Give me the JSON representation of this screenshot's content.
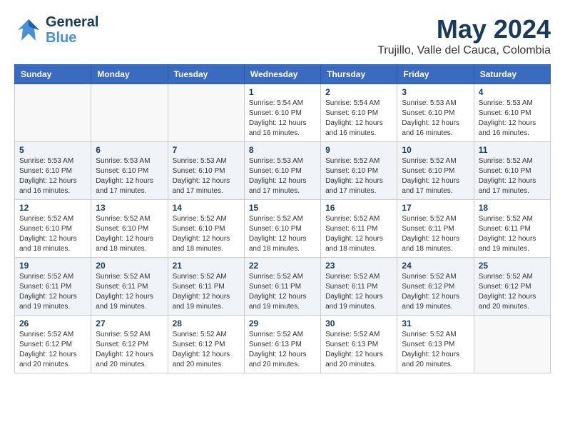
{
  "header": {
    "logo_line1": "General",
    "logo_line2": "Blue",
    "title": "May 2024",
    "subtitle": "Trujillo, Valle del Cauca, Colombia"
  },
  "weekdays": [
    "Sunday",
    "Monday",
    "Tuesday",
    "Wednesday",
    "Thursday",
    "Friday",
    "Saturday"
  ],
  "weeks": [
    [
      {
        "day": "",
        "info": ""
      },
      {
        "day": "",
        "info": ""
      },
      {
        "day": "",
        "info": ""
      },
      {
        "day": "1",
        "info": "Sunrise: 5:54 AM\nSunset: 6:10 PM\nDaylight: 12 hours\nand 16 minutes."
      },
      {
        "day": "2",
        "info": "Sunrise: 5:54 AM\nSunset: 6:10 PM\nDaylight: 12 hours\nand 16 minutes."
      },
      {
        "day": "3",
        "info": "Sunrise: 5:53 AM\nSunset: 6:10 PM\nDaylight: 12 hours\nand 16 minutes."
      },
      {
        "day": "4",
        "info": "Sunrise: 5:53 AM\nSunset: 6:10 PM\nDaylight: 12 hours\nand 16 minutes."
      }
    ],
    [
      {
        "day": "5",
        "info": "Sunrise: 5:53 AM\nSunset: 6:10 PM\nDaylight: 12 hours\nand 16 minutes."
      },
      {
        "day": "6",
        "info": "Sunrise: 5:53 AM\nSunset: 6:10 PM\nDaylight: 12 hours\nand 17 minutes."
      },
      {
        "day": "7",
        "info": "Sunrise: 5:53 AM\nSunset: 6:10 PM\nDaylight: 12 hours\nand 17 minutes."
      },
      {
        "day": "8",
        "info": "Sunrise: 5:53 AM\nSunset: 6:10 PM\nDaylight: 12 hours\nand 17 minutes."
      },
      {
        "day": "9",
        "info": "Sunrise: 5:52 AM\nSunset: 6:10 PM\nDaylight: 12 hours\nand 17 minutes."
      },
      {
        "day": "10",
        "info": "Sunrise: 5:52 AM\nSunset: 6:10 PM\nDaylight: 12 hours\nand 17 minutes."
      },
      {
        "day": "11",
        "info": "Sunrise: 5:52 AM\nSunset: 6:10 PM\nDaylight: 12 hours\nand 17 minutes."
      }
    ],
    [
      {
        "day": "12",
        "info": "Sunrise: 5:52 AM\nSunset: 6:10 PM\nDaylight: 12 hours\nand 18 minutes."
      },
      {
        "day": "13",
        "info": "Sunrise: 5:52 AM\nSunset: 6:10 PM\nDaylight: 12 hours\nand 18 minutes."
      },
      {
        "day": "14",
        "info": "Sunrise: 5:52 AM\nSunset: 6:10 PM\nDaylight: 12 hours\nand 18 minutes."
      },
      {
        "day": "15",
        "info": "Sunrise: 5:52 AM\nSunset: 6:10 PM\nDaylight: 12 hours\nand 18 minutes."
      },
      {
        "day": "16",
        "info": "Sunrise: 5:52 AM\nSunset: 6:11 PM\nDaylight: 12 hours\nand 18 minutes."
      },
      {
        "day": "17",
        "info": "Sunrise: 5:52 AM\nSunset: 6:11 PM\nDaylight: 12 hours\nand 18 minutes."
      },
      {
        "day": "18",
        "info": "Sunrise: 5:52 AM\nSunset: 6:11 PM\nDaylight: 12 hours\nand 19 minutes."
      }
    ],
    [
      {
        "day": "19",
        "info": "Sunrise: 5:52 AM\nSunset: 6:11 PM\nDaylight: 12 hours\nand 19 minutes."
      },
      {
        "day": "20",
        "info": "Sunrise: 5:52 AM\nSunset: 6:11 PM\nDaylight: 12 hours\nand 19 minutes."
      },
      {
        "day": "21",
        "info": "Sunrise: 5:52 AM\nSunset: 6:11 PM\nDaylight: 12 hours\nand 19 minutes."
      },
      {
        "day": "22",
        "info": "Sunrise: 5:52 AM\nSunset: 6:11 PM\nDaylight: 12 hours\nand 19 minutes."
      },
      {
        "day": "23",
        "info": "Sunrise: 5:52 AM\nSunset: 6:11 PM\nDaylight: 12 hours\nand 19 minutes."
      },
      {
        "day": "24",
        "info": "Sunrise: 5:52 AM\nSunset: 6:12 PM\nDaylight: 12 hours\nand 19 minutes."
      },
      {
        "day": "25",
        "info": "Sunrise: 5:52 AM\nSunset: 6:12 PM\nDaylight: 12 hours\nand 20 minutes."
      }
    ],
    [
      {
        "day": "26",
        "info": "Sunrise: 5:52 AM\nSunset: 6:12 PM\nDaylight: 12 hours\nand 20 minutes."
      },
      {
        "day": "27",
        "info": "Sunrise: 5:52 AM\nSunset: 6:12 PM\nDaylight: 12 hours\nand 20 minutes."
      },
      {
        "day": "28",
        "info": "Sunrise: 5:52 AM\nSunset: 6:12 PM\nDaylight: 12 hours\nand 20 minutes."
      },
      {
        "day": "29",
        "info": "Sunrise: 5:52 AM\nSunset: 6:13 PM\nDaylight: 12 hours\nand 20 minutes."
      },
      {
        "day": "30",
        "info": "Sunrise: 5:52 AM\nSunset: 6:13 PM\nDaylight: 12 hours\nand 20 minutes."
      },
      {
        "day": "31",
        "info": "Sunrise: 5:52 AM\nSunset: 6:13 PM\nDaylight: 12 hours\nand 20 minutes."
      },
      {
        "day": "",
        "info": ""
      }
    ]
  ]
}
